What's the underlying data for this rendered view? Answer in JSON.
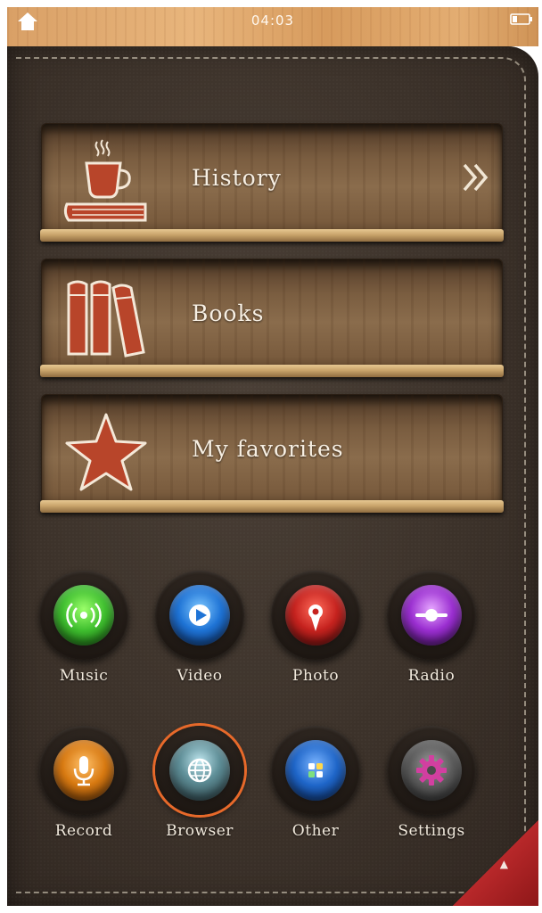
{
  "status_bar": {
    "time": "04:03",
    "left_icon": "home-icon",
    "right_icon": "battery-icon"
  },
  "shelves": [
    {
      "label": "History",
      "icon": "coffee-book-icon",
      "has_chevron": true
    },
    {
      "label": "Books",
      "icon": "books-icon",
      "has_chevron": false
    },
    {
      "label": "My favorites",
      "icon": "star-icon",
      "has_chevron": false
    }
  ],
  "apps": [
    {
      "label": "Music",
      "icon": "music-icon",
      "color": "#3fbf2f"
    },
    {
      "label": "Video",
      "icon": "video-icon",
      "color": "#1f74d6"
    },
    {
      "label": "Photo",
      "icon": "photo-icon",
      "color": "#c6231f"
    },
    {
      "label": "Radio",
      "icon": "radio-icon",
      "color": "#9b2fd1"
    },
    {
      "label": "Record",
      "icon": "microphone-icon",
      "color": "#d87a12"
    },
    {
      "label": "Browser",
      "icon": "globe-icon",
      "color": "#5a6a70",
      "selected": true
    },
    {
      "label": "Other",
      "icon": "apps-icon",
      "color": "#1f66c9"
    },
    {
      "label": "Settings",
      "icon": "gear-icon",
      "color": "#b23a8f"
    }
  ],
  "colors": {
    "leather": "#3c322a",
    "wood": "#7a5d40",
    "stitch": "#e6dcc8",
    "accent_corner": "#b8282a",
    "selected_ring": "#e7692a"
  }
}
